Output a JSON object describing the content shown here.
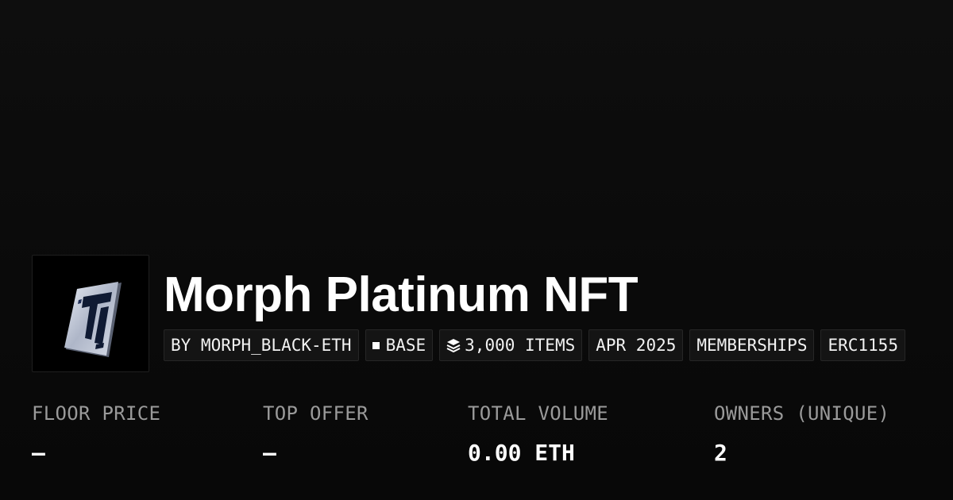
{
  "collection": {
    "title": "Morph Platinum NFT",
    "logo_icon": "morph-platinum-card-icon"
  },
  "tags": {
    "creator": "BY MORPH_BLACK-ETH",
    "chain": "BASE",
    "chain_icon": "square-icon",
    "items": "3,000 ITEMS",
    "items_icon": "layers-icon",
    "date": "APR 2025",
    "category": "MEMBERSHIPS",
    "standard": "ERC1155"
  },
  "stats": {
    "floor_price": {
      "label": "FLOOR PRICE",
      "value": "–"
    },
    "top_offer": {
      "label": "TOP OFFER",
      "value": "–"
    },
    "total_volume": {
      "label": "TOTAL VOLUME",
      "value": "0.00 ETH"
    },
    "owners": {
      "label": "OWNERS (UNIQUE)",
      "value": "2"
    }
  },
  "colors": {
    "background": "#0b0b0b",
    "tag_background": "#141414",
    "label_gray": "#9a9a9a",
    "text": "#ffffff"
  }
}
